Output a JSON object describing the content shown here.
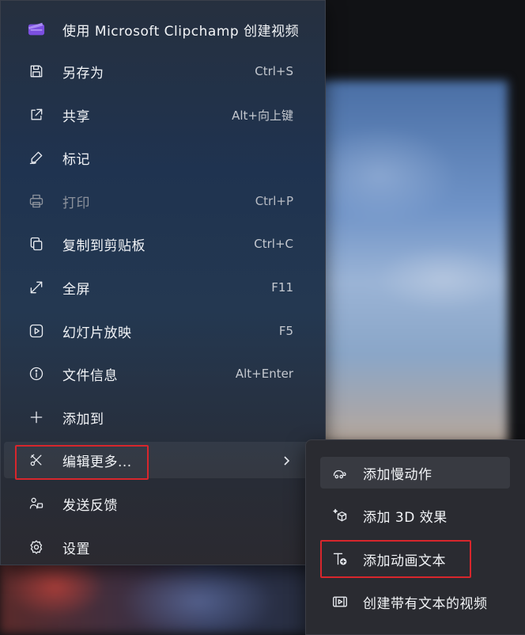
{
  "menu": {
    "items": [
      {
        "label": "使用 Microsoft Clipchamp 创建视频",
        "shortcut": "",
        "icon": "clipchamp-icon"
      },
      {
        "label": "另存为",
        "shortcut": "Ctrl+S",
        "icon": "save-icon"
      },
      {
        "label": "共享",
        "shortcut": "Alt+向上键",
        "icon": "share-icon"
      },
      {
        "label": "标记",
        "shortcut": "",
        "icon": "markup-icon"
      },
      {
        "label": "打印",
        "shortcut": "Ctrl+P",
        "icon": "print-icon",
        "disabled": true
      },
      {
        "label": "复制到剪贴板",
        "shortcut": "Ctrl+C",
        "icon": "copy-icon"
      },
      {
        "label": "全屏",
        "shortcut": "F11",
        "icon": "fullscreen-icon"
      },
      {
        "label": "幻灯片放映",
        "shortcut": "F5",
        "icon": "slideshow-icon"
      },
      {
        "label": "文件信息",
        "shortcut": "Alt+Enter",
        "icon": "info-icon"
      },
      {
        "label": "添加到",
        "shortcut": "",
        "icon": "plus-icon"
      },
      {
        "label": "编辑更多...",
        "shortcut": "",
        "icon": "edit-more-icon",
        "has_submenu": true
      },
      {
        "label": "发送反馈",
        "shortcut": "",
        "icon": "feedback-icon"
      },
      {
        "label": "设置",
        "shortcut": "",
        "icon": "gear-icon"
      }
    ]
  },
  "submenu": {
    "items": [
      {
        "label": "添加慢动作",
        "icon": "slow-motion-icon"
      },
      {
        "label": "添加 3D 效果",
        "icon": "3d-effects-icon"
      },
      {
        "label": "添加动画文本",
        "icon": "animated-text-icon"
      },
      {
        "label": "创建带有文本的视频",
        "icon": "video-text-icon"
      }
    ]
  },
  "colors": {
    "highlight_border": "#d8262c",
    "clipchamp_accent": "#7b4fe0"
  }
}
